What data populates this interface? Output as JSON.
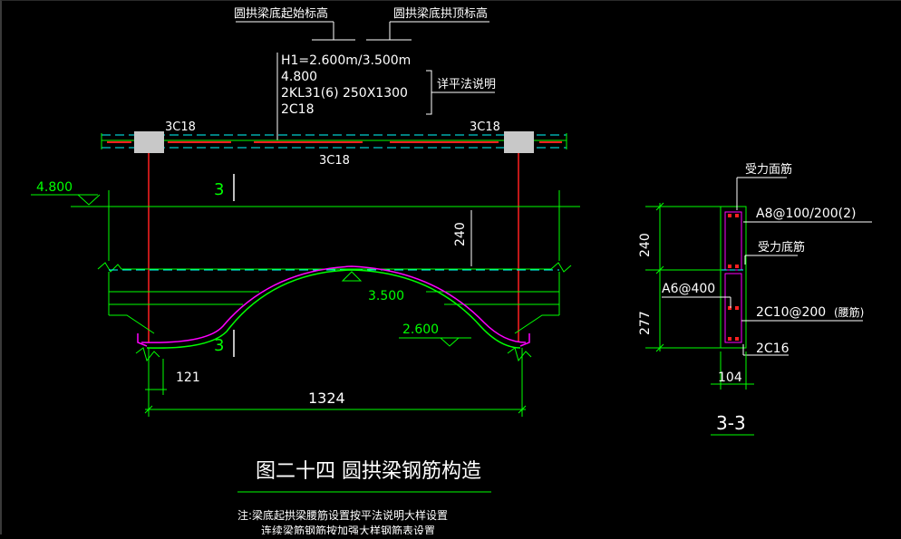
{
  "labels": {
    "start_elev_label": "圆拱梁底起始标高",
    "crown_elev_label": "圆拱梁底拱顶标高",
    "h1": "H1=2.600m/3.500m",
    "elev_top": "4.800",
    "beam_spec": "2KL31(6) 250X1300",
    "bars_2c18": "2C18",
    "see_note": "详平法说明",
    "top_bar_left": "3C18",
    "top_bar_right": "3C18",
    "bottom_bar": "3C18",
    "elev_left": "4.800",
    "section_mark_top": "3",
    "section_mark_bottom": "3",
    "dim_240": "240",
    "elev_crown": "3.500",
    "elev_2600": "2.600",
    "dim_121": "121",
    "dim_1324": "1324",
    "title": "图二十四  圆拱梁钢筋构造",
    "note_line1": "注:梁底起拱梁腰筋设置按平法说明大样设置",
    "note_line2": "连续梁筋钢筋按加强大样钢筋表设置"
  },
  "section": {
    "label_top_bar": "受力面筋",
    "stirrup": "A8@100/200(2)",
    "label_bottom_bar": "受力底筋",
    "tie": "A6@400",
    "waist_bar": "2C10@200",
    "waist_note": "(腰筋)",
    "bottom_bars": "2C16",
    "dim_240": "240",
    "dim_277": "277",
    "dim_104": "104",
    "section_title": "3-3"
  },
  "colors": {
    "green": "#00ff00",
    "red": "#ff2020",
    "magenta": "#ff00ff",
    "white": "#ffffff",
    "yellow": "#ffff00",
    "cyan": "#00ffff",
    "grey_block": "#c8c8c8"
  }
}
